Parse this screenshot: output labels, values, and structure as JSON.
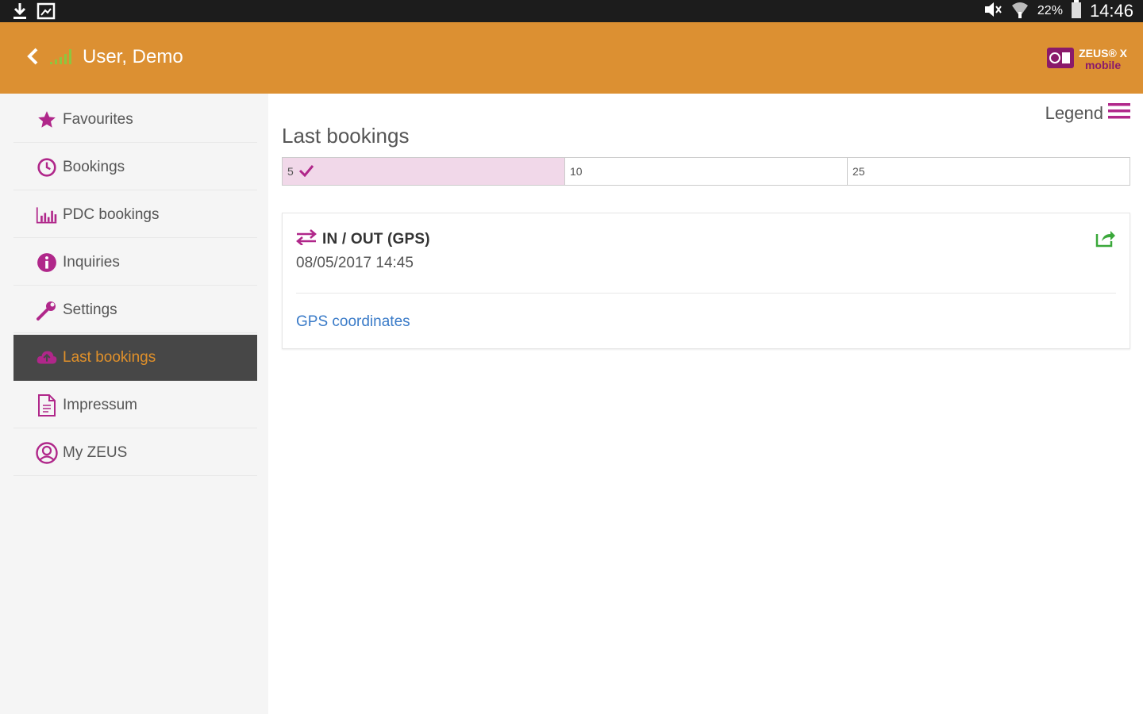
{
  "status_bar": {
    "battery_percent": "22%",
    "time": "14:46"
  },
  "app_bar": {
    "user_name": "User, Demo",
    "logo": {
      "line1": "ZEUS® X",
      "line2": "mobile"
    }
  },
  "sidebar": {
    "items": [
      {
        "label": "Favourites",
        "icon": "star-icon"
      },
      {
        "label": "Bookings",
        "icon": "clock-icon"
      },
      {
        "label": "PDC bookings",
        "icon": "bar-chart-icon"
      },
      {
        "label": "Inquiries",
        "icon": "info-icon"
      },
      {
        "label": "Settings",
        "icon": "wrench-icon"
      },
      {
        "label": "Last bookings",
        "icon": "cloud-upload-icon",
        "active": true
      },
      {
        "label": "Impressum",
        "icon": "document-icon"
      },
      {
        "label": "My ZEUS",
        "icon": "user-icon"
      }
    ]
  },
  "main": {
    "legend_label": "Legend",
    "title": "Last bookings",
    "segments": [
      {
        "label": "5",
        "selected": true
      },
      {
        "label": "10",
        "selected": false
      },
      {
        "label": "25",
        "selected": false
      }
    ],
    "booking": {
      "type": "IN / OUT (GPS)",
      "datetime": "08/05/2017 14:45",
      "link": "GPS coordinates"
    }
  },
  "colors": {
    "app_bar": "#dc9032",
    "accent_purple": "#b0278a",
    "active_nav_bg": "#474747",
    "active_nav_text": "#e0902a",
    "link": "#3a7bc8",
    "share_green": "#3aa83a"
  }
}
